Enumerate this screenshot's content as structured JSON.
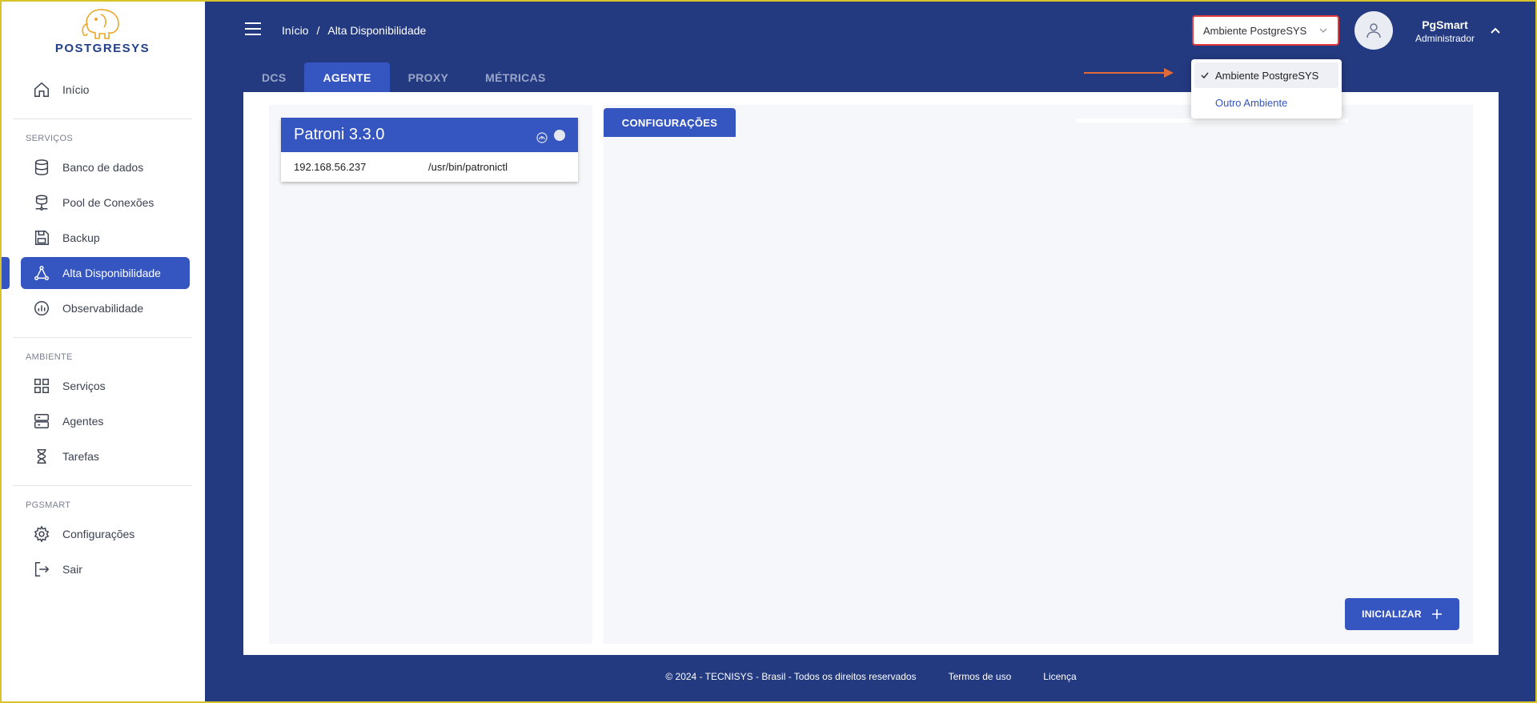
{
  "brand": {
    "name": "POSTGRESYS",
    "logo_icon": "elephant-icon",
    "logo_color": "#e8a82a"
  },
  "sidebar": {
    "home": {
      "label": "Início",
      "icon": "home-icon"
    },
    "sections": [
      {
        "label": "SERVIÇOS"
      },
      {
        "label": "AMBIENTE"
      },
      {
        "label": "PGSMART"
      }
    ],
    "items": [
      {
        "label": "Banco de dados",
        "icon": "database-icon"
      },
      {
        "label": "Pool de Conexões",
        "icon": "connection-pool-icon"
      },
      {
        "label": "Backup",
        "icon": "floppy-disk-icon"
      },
      {
        "label": "Alta Disponibilidade",
        "icon": "triangle-nodes-icon",
        "active": true
      },
      {
        "label": "Observabilidade",
        "icon": "chart-circle-icon"
      },
      {
        "label": "Serviços",
        "icon": "grid-icon"
      },
      {
        "label": "Agentes",
        "icon": "server-icon"
      },
      {
        "label": "Tarefas",
        "icon": "hourglass-icon"
      },
      {
        "label": "Configurações",
        "icon": "gear-icon"
      },
      {
        "label": "Sair",
        "icon": "logout-icon"
      }
    ]
  },
  "header": {
    "breadcrumb": [
      "Início",
      "/",
      "Alta Disponibilidade"
    ],
    "environment_select": {
      "value": "Ambiente PostgreSYS"
    },
    "user": {
      "name": "PgSmart",
      "role": "Administrador"
    }
  },
  "environment_dropdown": {
    "options": [
      {
        "label": "Ambiente PostgreSYS",
        "selected": true
      },
      {
        "label": "Outro Ambiente",
        "selected": false
      }
    ]
  },
  "tabs": [
    {
      "label": "DCS",
      "active": false
    },
    {
      "label": "AGENTE",
      "active": true
    },
    {
      "label": "PROXY",
      "active": false
    },
    {
      "label": "MÉTRICAS",
      "active": false
    }
  ],
  "agent": {
    "title": "Patroni 3.3.0",
    "ip": "192.168.56.237",
    "path": "/usr/bin/patronictl"
  },
  "config_panel": {
    "tab_label": "CONFIGURAÇÕES",
    "init_button": "INICIALIZAR"
  },
  "footer": {
    "copyright": "© 2024 - TECNISYS - Brasil - Todos os direitos reservados",
    "terms": "Termos de uso",
    "license": "Licença"
  },
  "colors": {
    "navy": "#243a80",
    "accent": "#3555c0",
    "highlight": "#e03a3a",
    "arrow": "#e06a3a"
  }
}
